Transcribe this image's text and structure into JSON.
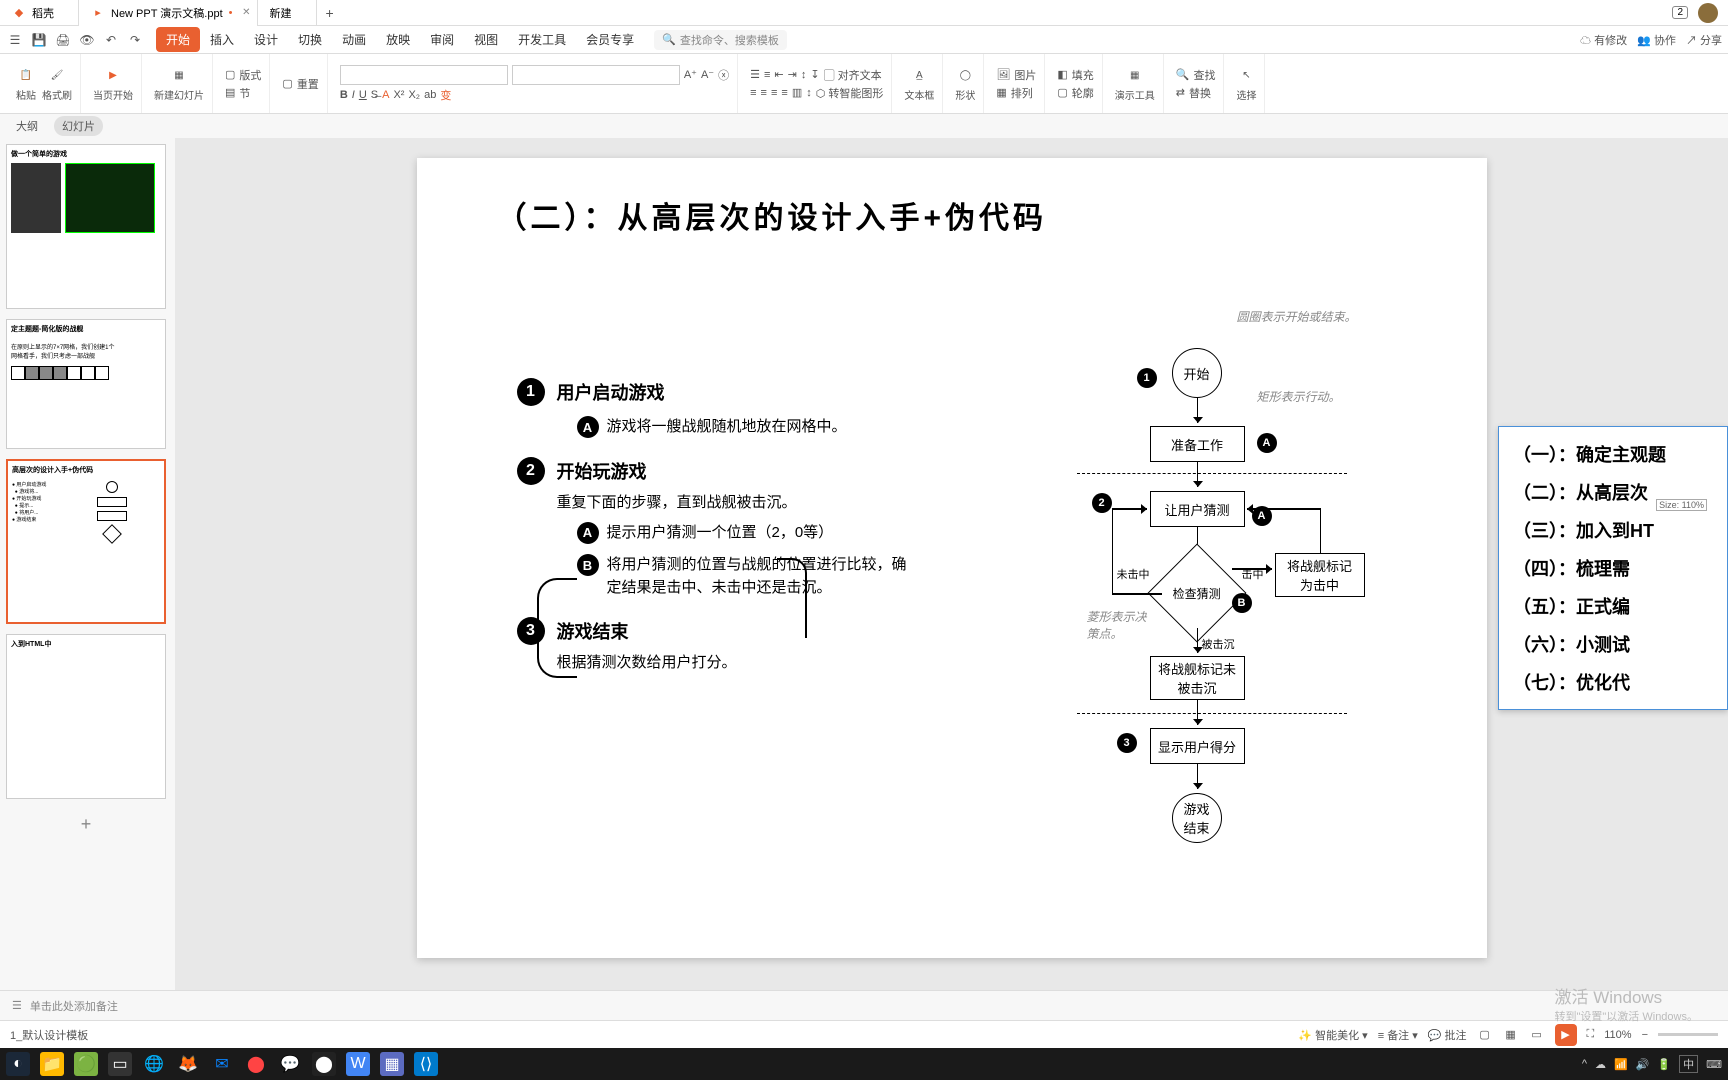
{
  "titlebar": {
    "tab1": "稻壳",
    "tab2": "New PPT 演示文稿.ppt",
    "tab3": "新建",
    "badge": "2"
  },
  "menu": {
    "start": "开始",
    "insert": "插入",
    "design": "设计",
    "transition": "切换",
    "animation": "动画",
    "slideshow": "放映",
    "review": "审阅",
    "view": "视图",
    "devtools": "开发工具",
    "member": "会员专享",
    "search_placeholder": "查找命令、搜索模板",
    "has_changes": "有修改",
    "collab": "协作",
    "share": "分享"
  },
  "ribbon": {
    "paste": "粘贴",
    "format_painter": "格式刷",
    "from_current": "当页开始",
    "new_slide": "新建幻灯片",
    "layout": "版式",
    "section": "节",
    "reset": "重置",
    "font_combo": "",
    "size_combo": "",
    "align_smart": "转智能图形",
    "align_obj": "对齐文本",
    "textbox": "文本框",
    "shape": "形状",
    "image": "图片",
    "fill": "填充",
    "arrange": "排列",
    "outline": "轮廓",
    "demo_tools": "演示工具",
    "find": "查找",
    "replace": "替换",
    "select": "选择"
  },
  "left_tabs": {
    "outline": "大纲",
    "slides": "幻灯片"
  },
  "slide": {
    "title": "（二）：从高层次的设计入手+伪代码",
    "step1": {
      "title": "用户启动游戏",
      "a": "游戏将一艘战舰随机地放在网格中。"
    },
    "step2": {
      "title": "开始玩游戏",
      "desc": "重复下面的步骤，直到战舰被击沉。",
      "a": "提示用户猜测一个位置（2，0等）",
      "b": "将用户猜测的位置与战舰的位置进行比较，确定结果是击中、未击中还是击沉。"
    },
    "step3": {
      "title": "游戏结束",
      "desc": "根据猜测次数给用户打分。"
    },
    "flow": {
      "start": "开始",
      "prepare": "准备工作",
      "guess": "让用户猜测",
      "check": "检查猜测",
      "hit": "将战舰标记为击中",
      "sink": "将战舰标记未被击沉",
      "score": "显示用户得分",
      "end": "游戏结束",
      "miss_label": "未击中",
      "hit_label": "击中",
      "sunk_label": "被击沉",
      "note1": "圆圈表示开始或结束。",
      "note2": "矩形表示行动。",
      "note3": "菱形表示决策点。"
    }
  },
  "outline_panel": {
    "i1": "（一）：确定主观题",
    "i2": "（二）：从高层次",
    "i3": "（三）：加入到HT",
    "i4": "（四）：梳理需",
    "i5": "（五）：正式编",
    "i6": "（六）：小测试",
    "i7": "（七）：优化代",
    "size": "Size: 110%"
  },
  "notes": {
    "placeholder": "单击此处添加备注"
  },
  "status": {
    "template": "1_默认设计模板",
    "smart": "智能美化",
    "notes_btn": "备注",
    "comments": "批注",
    "zoom": "110%"
  },
  "watermark": {
    "l1": "激活 Windows",
    "l2": "转到\"设置\"以激活 Windows。"
  },
  "taskbar": {
    "ime": "中"
  }
}
